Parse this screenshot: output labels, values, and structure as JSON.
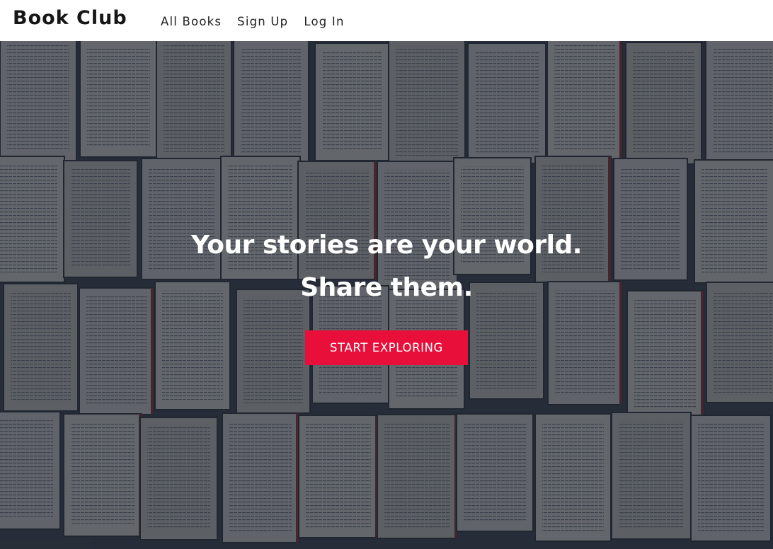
{
  "navbar": {
    "brand": "Book Club",
    "links": [
      {
        "label": "All Books"
      },
      {
        "label": "Sign Up"
      },
      {
        "label": "Log In"
      }
    ]
  },
  "hero": {
    "headline_line1": "Your stories are your world.",
    "headline_line2": "Share them.",
    "cta_label": "START EXPLORING",
    "background_image": "open-books-wall",
    "overlay_color": "#1c2430",
    "cta_color": "#e8103a"
  }
}
